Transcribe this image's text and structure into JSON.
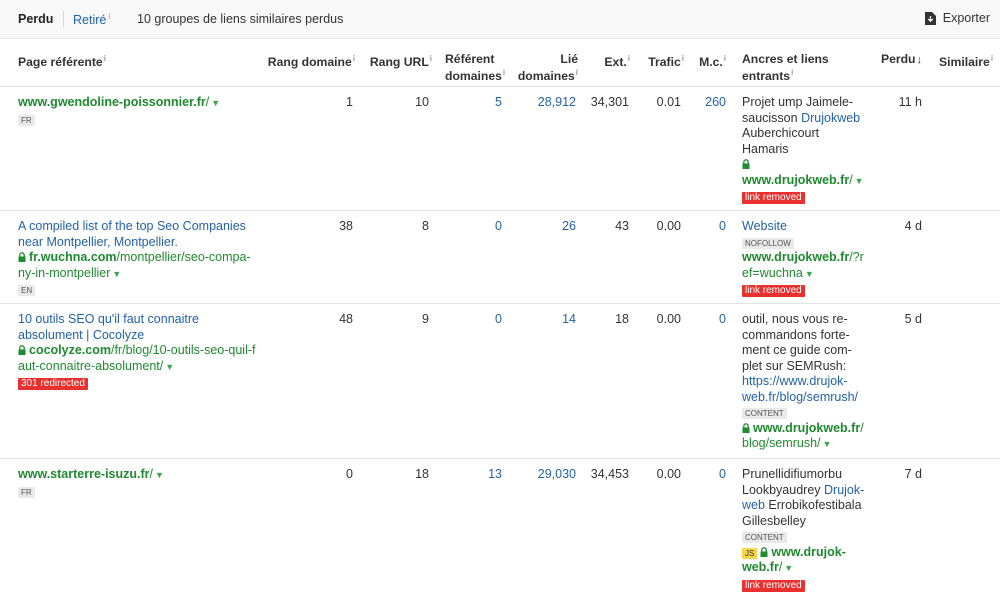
{
  "tabs": {
    "active": "Perdu",
    "other": "Retiré",
    "info": "i"
  },
  "summary": "10 groupes de liens similaires perdus",
  "export_label": "Exporter",
  "columns": {
    "page": "Page référente",
    "rang_domaine": "Rang domaine",
    "rang_url": "Rang URL",
    "ref_line1": "Référent",
    "ref_line2": "domaines",
    "lie_line1": "Lié",
    "lie_line2": "domaines",
    "ext": "Ext.",
    "trafic": "Trafic",
    "mc": "M.c.",
    "ancres_line1": "Ancres et liens",
    "ancres_line2": "entrants",
    "perdu": "Perdu",
    "similaire": "Similaire",
    "info": "i",
    "sort_arrow": "↓"
  },
  "rows": [
    {
      "page_title": "",
      "page_url_bold": "www.gwendoline-poissonnier.fr",
      "page_url_rest": "/",
      "lang": "FR",
      "rang_domaine": "1",
      "rang_url": "10",
      "ref_dom": "5",
      "lie_dom": "28,912",
      "ext": "34,301",
      "trafic": "0.01",
      "mc": "260",
      "anchor_lines": [
        "Projet ump Jaimele-",
        "saucisson"
      ],
      "anchor_link": "Drujokweb",
      "anchor_after": [
        "Auberchicourt",
        "Hamaris"
      ],
      "target_bold": "www.drujokweb.fr",
      "target_rest": "/",
      "status": "link removed",
      "perdu": "11 h"
    },
    {
      "page_title_lines": [
        "A compiled list of the top Seo Companies",
        "near Montpellier, Montpellier."
      ],
      "page_url_bold": "fr.wuchna.com",
      "page_url_rest_lines": [
        "/montpellier/seo-compa-",
        "ny-in-montpellier"
      ],
      "lang": "EN",
      "rang_domaine": "38",
      "rang_url": "8",
      "ref_dom": "0",
      "lie_dom": "26",
      "ext": "43",
      "trafic": "0.00",
      "mc": "0",
      "anchor_link": "Website",
      "anchor_badge": "NOFOLLOW",
      "target_bold": "www.drujokweb.fr",
      "target_rest_lines": [
        "/?r",
        "ef=wuchna"
      ],
      "status": "link removed",
      "perdu": "4 d"
    },
    {
      "page_title_lines": [
        "10 outils SEO qu'il faut connaitre",
        "absolument | Cocolyze"
      ],
      "page_url_bold": "cocolyze.com",
      "page_url_rest_lines": [
        "/fr/blog/10-outils-seo-quil-f",
        "aut-connaitre-absolument/"
      ],
      "redirect": "301 redirected",
      "rang_domaine": "48",
      "rang_url": "9",
      "ref_dom": "0",
      "lie_dom": "14",
      "ext": "18",
      "trafic": "0.00",
      "mc": "0",
      "anchor_lines": [
        "outil, nous vous re-",
        "commandons forte-",
        "ment ce guide com-",
        "plet sur SEMRush:"
      ],
      "anchor_link_lines": [
        "https://www.drujok-",
        "web.fr/blog/semrush/"
      ],
      "anchor_badge": "CONTENT",
      "target_bold": "www.drujokweb.fr",
      "target_rest_lines": [
        "/",
        "blog/semrush/"
      ],
      "perdu": "5 d"
    },
    {
      "page_url_bold": "www.starterre-isuzu.fr",
      "page_url_rest": "/",
      "lang": "FR",
      "rang_domaine": "0",
      "rang_url": "18",
      "ref_dom": "13",
      "lie_dom": "29,030",
      "ext": "34,453",
      "trafic": "0.00",
      "mc": "0",
      "anchor_text": "Prunellidifiumorbu",
      "anchor_mixed": "Lookbyaudrey",
      "anchor_link_lines": [
        "Drujok-",
        "web"
      ],
      "anchor_after": [
        "Errobikofestibala",
        "Gillesbelley"
      ],
      "anchor_badge": "CONTENT",
      "js_badge": "JS",
      "target_bold_lines": [
        "www.drujok-",
        "web.fr"
      ],
      "target_rest": "/",
      "status": "link removed",
      "perdu": "7 d"
    }
  ],
  "colors": {
    "link_blue": "#2262a8",
    "url_green": "#1f8a2f",
    "removed_red": "#e8312f",
    "header_bg": "#f8f8f8"
  },
  "icons": [
    "export-icon",
    "lock-icon",
    "dropdown-arrow-icon"
  ]
}
